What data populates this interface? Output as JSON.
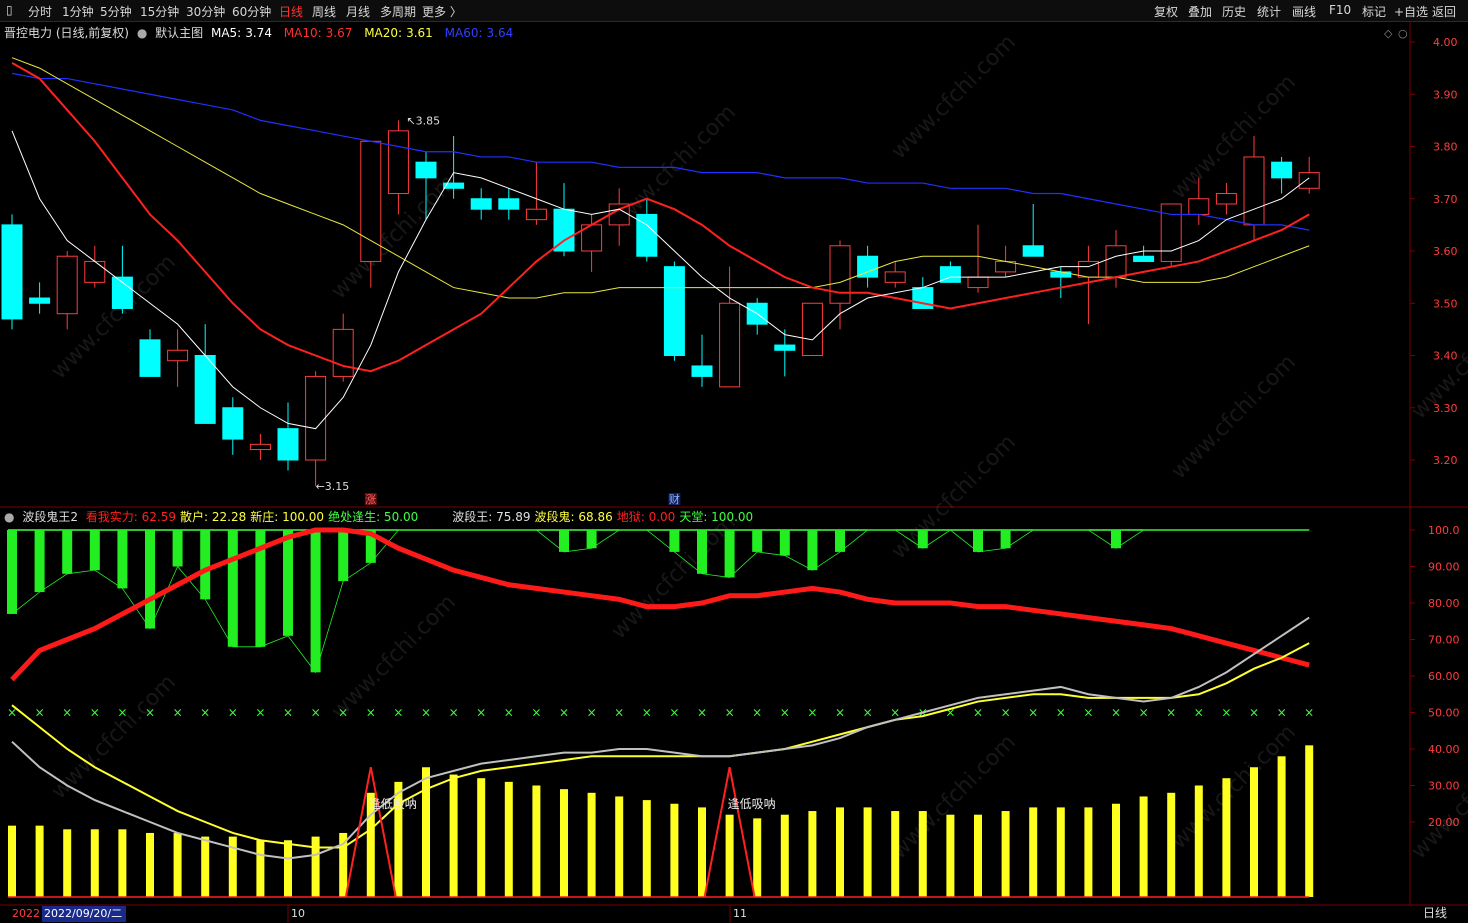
{
  "toolbar": {
    "left_items": [
      "分时",
      "1分钟",
      "5分钟",
      "15分钟",
      "30分钟",
      "60分钟",
      "日线",
      "周线",
      "月线",
      "多周期",
      "更多 〉"
    ],
    "active": "日线",
    "right_items": [
      "复权",
      "叠加",
      "历史",
      "统计",
      "画线",
      "F10",
      "标记",
      "+自选",
      "返回"
    ]
  },
  "main_legend": {
    "title": "晋控电力 (日线,前复权)",
    "template": "默认主图",
    "ma5_label": "MA5:",
    "ma5_value": "3.74",
    "ma10_label": "MA10:",
    "ma10_value": "3.67",
    "ma20_label": "MA20:",
    "ma20_value": "3.61",
    "ma60_label": "MA60:",
    "ma60_value": "3.64"
  },
  "sub_legend": {
    "name": "波段鬼王2",
    "items": [
      {
        "label": "看我实力:",
        "value": "62.59",
        "color": "#ff2020"
      },
      {
        "label": "散户:",
        "value": "22.28",
        "color": "#ffff40"
      },
      {
        "label": "新庄:",
        "value": "100.00",
        "color": "#ffff40"
      },
      {
        "label": "绝处逢生:",
        "value": "50.00",
        "color": "#40ff40"
      },
      {
        "label": "波段王:",
        "value": "75.89",
        "color": "#e0e0e0"
      },
      {
        "label": "波段鬼:",
        "value": "68.86",
        "color": "#ffff40"
      },
      {
        "label": "地狱:",
        "value": "0.00",
        "color": "#ff2020"
      },
      {
        "label": "天堂:",
        "value": "100.00",
        "color": "#40ff40"
      }
    ]
  },
  "price_axis": [
    "4.00",
    "3.90",
    "3.80",
    "3.70",
    "3.60",
    "3.50",
    "3.40",
    "3.30",
    "3.20"
  ],
  "sub_axis": [
    "100.0",
    "90.00",
    "80.00",
    "70.00",
    "60.00",
    "50.00",
    "40.00",
    "30.00",
    "20.00"
  ],
  "annotations": {
    "high": "3.85",
    "low": "3.15",
    "zhang": "涨",
    "cai": "财",
    "signal1": "逢低吸呐",
    "signal2": "逢低吸呐"
  },
  "date_axis": {
    "year": "2022",
    "cursor_date": "2022/09/20/二",
    "month1": "10",
    "month2": "11",
    "period_label": "日线"
  },
  "watermark": "www.cfchi.com",
  "colors": {
    "up": "#ff3c3c",
    "down": "#00ffff",
    "ma5": "#ffffff",
    "ma10": "#ff2020",
    "ma20": "#e8e840",
    "ma60": "#2030ff",
    "grid": "#7a0000"
  },
  "chart_data": {
    "type": "candlestick",
    "candles": [
      {
        "o": 3.65,
        "h": 3.67,
        "l": 3.45,
        "c": 3.47
      },
      {
        "o": 3.51,
        "h": 3.54,
        "l": 3.48,
        "c": 3.5
      },
      {
        "o": 3.48,
        "h": 3.6,
        "l": 3.45,
        "c": 3.59
      },
      {
        "o": 3.54,
        "h": 3.61,
        "l": 3.53,
        "c": 3.58
      },
      {
        "o": 3.55,
        "h": 3.61,
        "l": 3.48,
        "c": 3.49
      },
      {
        "o": 3.43,
        "h": 3.45,
        "l": 3.36,
        "c": 3.36
      },
      {
        "o": 3.39,
        "h": 3.45,
        "l": 3.34,
        "c": 3.41
      },
      {
        "o": 3.4,
        "h": 3.46,
        "l": 3.27,
        "c": 3.27
      },
      {
        "o": 3.3,
        "h": 3.32,
        "l": 3.21,
        "c": 3.24
      },
      {
        "o": 3.22,
        "h": 3.25,
        "l": 3.2,
        "c": 3.23
      },
      {
        "o": 3.26,
        "h": 3.31,
        "l": 3.18,
        "c": 3.2
      },
      {
        "o": 3.2,
        "h": 3.37,
        "l": 3.15,
        "c": 3.36
      },
      {
        "o": 3.36,
        "h": 3.48,
        "l": 3.35,
        "c": 3.45
      },
      {
        "o": 3.58,
        "h": 3.81,
        "l": 3.53,
        "c": 3.81
      },
      {
        "o": 3.71,
        "h": 3.85,
        "l": 3.67,
        "c": 3.83
      },
      {
        "o": 3.77,
        "h": 3.79,
        "l": 3.66,
        "c": 3.74
      },
      {
        "o": 3.73,
        "h": 3.82,
        "l": 3.7,
        "c": 3.72
      },
      {
        "o": 3.7,
        "h": 3.72,
        "l": 3.66,
        "c": 3.68
      },
      {
        "o": 3.7,
        "h": 3.72,
        "l": 3.66,
        "c": 3.68
      },
      {
        "o": 3.66,
        "h": 3.77,
        "l": 3.65,
        "c": 3.68
      },
      {
        "o": 3.68,
        "h": 3.73,
        "l": 3.59,
        "c": 3.6
      },
      {
        "o": 3.6,
        "h": 3.67,
        "l": 3.56,
        "c": 3.65
      },
      {
        "o": 3.65,
        "h": 3.72,
        "l": 3.61,
        "c": 3.69
      },
      {
        "o": 3.67,
        "h": 3.7,
        "l": 3.58,
        "c": 3.59
      },
      {
        "o": 3.57,
        "h": 3.58,
        "l": 3.39,
        "c": 3.4
      },
      {
        "o": 3.38,
        "h": 3.44,
        "l": 3.34,
        "c": 3.36
      },
      {
        "o": 3.34,
        "h": 3.57,
        "l": 3.34,
        "c": 3.5
      },
      {
        "o": 3.5,
        "h": 3.51,
        "l": 3.44,
        "c": 3.46
      },
      {
        "o": 3.42,
        "h": 3.45,
        "l": 3.36,
        "c": 3.41
      },
      {
        "o": 3.4,
        "h": 3.5,
        "l": 3.4,
        "c": 3.5
      },
      {
        "o": 3.5,
        "h": 3.62,
        "l": 3.45,
        "c": 3.61
      },
      {
        "o": 3.59,
        "h": 3.61,
        "l": 3.53,
        "c": 3.55
      },
      {
        "o": 3.54,
        "h": 3.58,
        "l": 3.53,
        "c": 3.56
      },
      {
        "o": 3.53,
        "h": 3.55,
        "l": 3.49,
        "c": 3.49
      },
      {
        "o": 3.57,
        "h": 3.58,
        "l": 3.54,
        "c": 3.54
      },
      {
        "o": 3.53,
        "h": 3.65,
        "l": 3.52,
        "c": 3.55
      },
      {
        "o": 3.56,
        "h": 3.61,
        "l": 3.55,
        "c": 3.58
      },
      {
        "o": 3.61,
        "h": 3.69,
        "l": 3.59,
        "c": 3.59
      },
      {
        "o": 3.56,
        "h": 3.57,
        "l": 3.51,
        "c": 3.55
      },
      {
        "o": 3.55,
        "h": 3.61,
        "l": 3.46,
        "c": 3.58
      },
      {
        "o": 3.55,
        "h": 3.64,
        "l": 3.53,
        "c": 3.61
      },
      {
        "o": 3.59,
        "h": 3.61,
        "l": 3.58,
        "c": 3.58
      },
      {
        "o": 3.58,
        "h": 3.69,
        "l": 3.57,
        "c": 3.69
      },
      {
        "o": 3.67,
        "h": 3.74,
        "l": 3.65,
        "c": 3.7
      },
      {
        "o": 3.69,
        "h": 3.73,
        "l": 3.67,
        "c": 3.71
      },
      {
        "o": 3.65,
        "h": 3.82,
        "l": 3.62,
        "c": 3.78
      },
      {
        "o": 3.77,
        "h": 3.78,
        "l": 3.71,
        "c": 3.74
      },
      {
        "o": 3.72,
        "h": 3.78,
        "l": 3.71,
        "c": 3.75
      }
    ],
    "ma5": [
      3.83,
      3.7,
      3.62,
      3.58,
      3.54,
      3.5,
      3.46,
      3.4,
      3.34,
      3.3,
      3.27,
      3.26,
      3.32,
      3.42,
      3.56,
      3.66,
      3.75,
      3.74,
      3.72,
      3.7,
      3.68,
      3.67,
      3.68,
      3.65,
      3.6,
      3.55,
      3.51,
      3.48,
      3.44,
      3.43,
      3.48,
      3.51,
      3.52,
      3.53,
      3.55,
      3.55,
      3.55,
      3.56,
      3.57,
      3.57,
      3.59,
      3.6,
      3.6,
      3.62,
      3.66,
      3.68,
      3.7,
      3.74
    ],
    "ma10": [
      3.96,
      3.93,
      3.87,
      3.81,
      3.74,
      3.67,
      3.62,
      3.56,
      3.5,
      3.45,
      3.42,
      3.4,
      3.38,
      3.37,
      3.39,
      3.42,
      3.45,
      3.48,
      3.53,
      3.58,
      3.62,
      3.65,
      3.68,
      3.7,
      3.68,
      3.65,
      3.61,
      3.58,
      3.55,
      3.53,
      3.52,
      3.52,
      3.51,
      3.5,
      3.49,
      3.5,
      3.51,
      3.52,
      3.53,
      3.54,
      3.55,
      3.56,
      3.57,
      3.58,
      3.6,
      3.62,
      3.64,
      3.67
    ],
    "ma20": [
      3.97,
      3.95,
      3.92,
      3.89,
      3.86,
      3.83,
      3.8,
      3.77,
      3.74,
      3.71,
      3.69,
      3.67,
      3.65,
      3.62,
      3.59,
      3.56,
      3.53,
      3.52,
      3.51,
      3.51,
      3.52,
      3.52,
      3.53,
      3.53,
      3.53,
      3.53,
      3.53,
      3.53,
      3.53,
      3.53,
      3.54,
      3.56,
      3.58,
      3.59,
      3.59,
      3.59,
      3.58,
      3.57,
      3.56,
      3.55,
      3.55,
      3.54,
      3.54,
      3.54,
      3.55,
      3.57,
      3.59,
      3.61
    ],
    "ma60": [
      3.94,
      3.93,
      3.93,
      3.92,
      3.91,
      3.9,
      3.89,
      3.88,
      3.87,
      3.85,
      3.84,
      3.83,
      3.82,
      3.81,
      3.8,
      3.79,
      3.79,
      3.78,
      3.78,
      3.77,
      3.77,
      3.77,
      3.76,
      3.76,
      3.76,
      3.75,
      3.75,
      3.75,
      3.74,
      3.74,
      3.74,
      3.73,
      3.73,
      3.73,
      3.72,
      3.72,
      3.72,
      3.71,
      3.71,
      3.7,
      3.69,
      3.68,
      3.67,
      3.67,
      3.66,
      3.65,
      3.65,
      3.64
    ],
    "sub": {
      "green_bars": [
        77,
        83,
        88,
        89,
        84,
        73,
        90,
        81,
        68,
        68,
        71,
        61,
        86,
        91,
        100,
        100,
        100,
        100,
        100,
        100,
        94,
        95,
        100,
        100,
        94,
        88,
        87,
        94,
        93,
        89,
        94,
        100,
        100,
        95,
        100,
        94,
        95,
        100,
        100,
        100,
        95,
        100,
        100,
        100,
        100,
        100,
        100,
        100
      ],
      "red_line": [
        59,
        67,
        70,
        73,
        77,
        81,
        85,
        89,
        92,
        95,
        98,
        100,
        100,
        99,
        95,
        92,
        89,
        87,
        85,
        84,
        83,
        82,
        81,
        79,
        79,
        80,
        82,
        82,
        83,
        84,
        83,
        81,
        80,
        80,
        80,
        79,
        79,
        78,
        77,
        76,
        75,
        74,
        73,
        71,
        69,
        67,
        65,
        63
      ],
      "white_line": [
        42,
        35,
        30,
        26,
        23,
        20,
        17,
        15,
        13,
        11,
        10,
        11,
        14,
        22,
        28,
        32,
        34,
        36,
        37,
        38,
        39,
        39,
        40,
        40,
        39,
        38,
        38,
        39,
        40,
        41,
        43,
        46,
        48,
        50,
        52,
        54,
        55,
        56,
        57,
        55,
        54,
        53,
        54,
        57,
        61,
        66,
        71,
        76
      ],
      "yellow_line": [
        52,
        46,
        40,
        35,
        31,
        27,
        23,
        20,
        17,
        15,
        14,
        13,
        13,
        18,
        25,
        29,
        32,
        34,
        35,
        36,
        37,
        38,
        38,
        38,
        38,
        38,
        38,
        39,
        40,
        42,
        44,
        46,
        48,
        49,
        51,
        53,
        54,
        55,
        55,
        54,
        54,
        54,
        54,
        55,
        58,
        62,
        65,
        69
      ],
      "yellow_bars": [
        19,
        19,
        18,
        18,
        18,
        17,
        17,
        16,
        16,
        15,
        15,
        16,
        17,
        28,
        31,
        35,
        33,
        32,
        31,
        30,
        29,
        28,
        27,
        26,
        25,
        24,
        22,
        21,
        22,
        23,
        24,
        24,
        23,
        23,
        22,
        22,
        23,
        24,
        24,
        24,
        25,
        27,
        28,
        30,
        32,
        35,
        38,
        41
      ],
      "signals": [
        13,
        26
      ],
      "signal_peak": 35,
      "flat_marker": 50
    }
  }
}
